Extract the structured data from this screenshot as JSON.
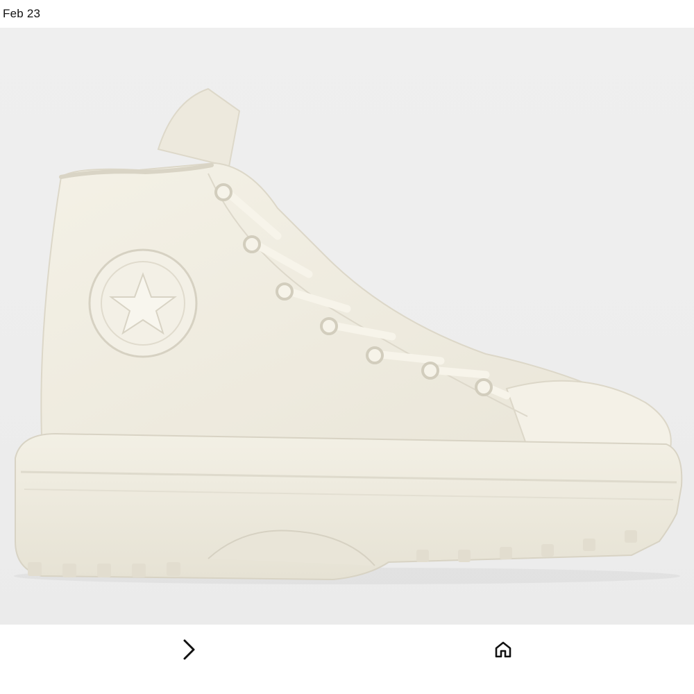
{
  "status_bar": {
    "date": "Feb 23"
  },
  "photo": {
    "subject": "sneaker-photo",
    "background_color": "#eeeeee",
    "shoe_color": "#f2efe4"
  },
  "bottom_bar": {
    "next_icon": "chevron-right-icon",
    "home_icon": "home-icon"
  }
}
